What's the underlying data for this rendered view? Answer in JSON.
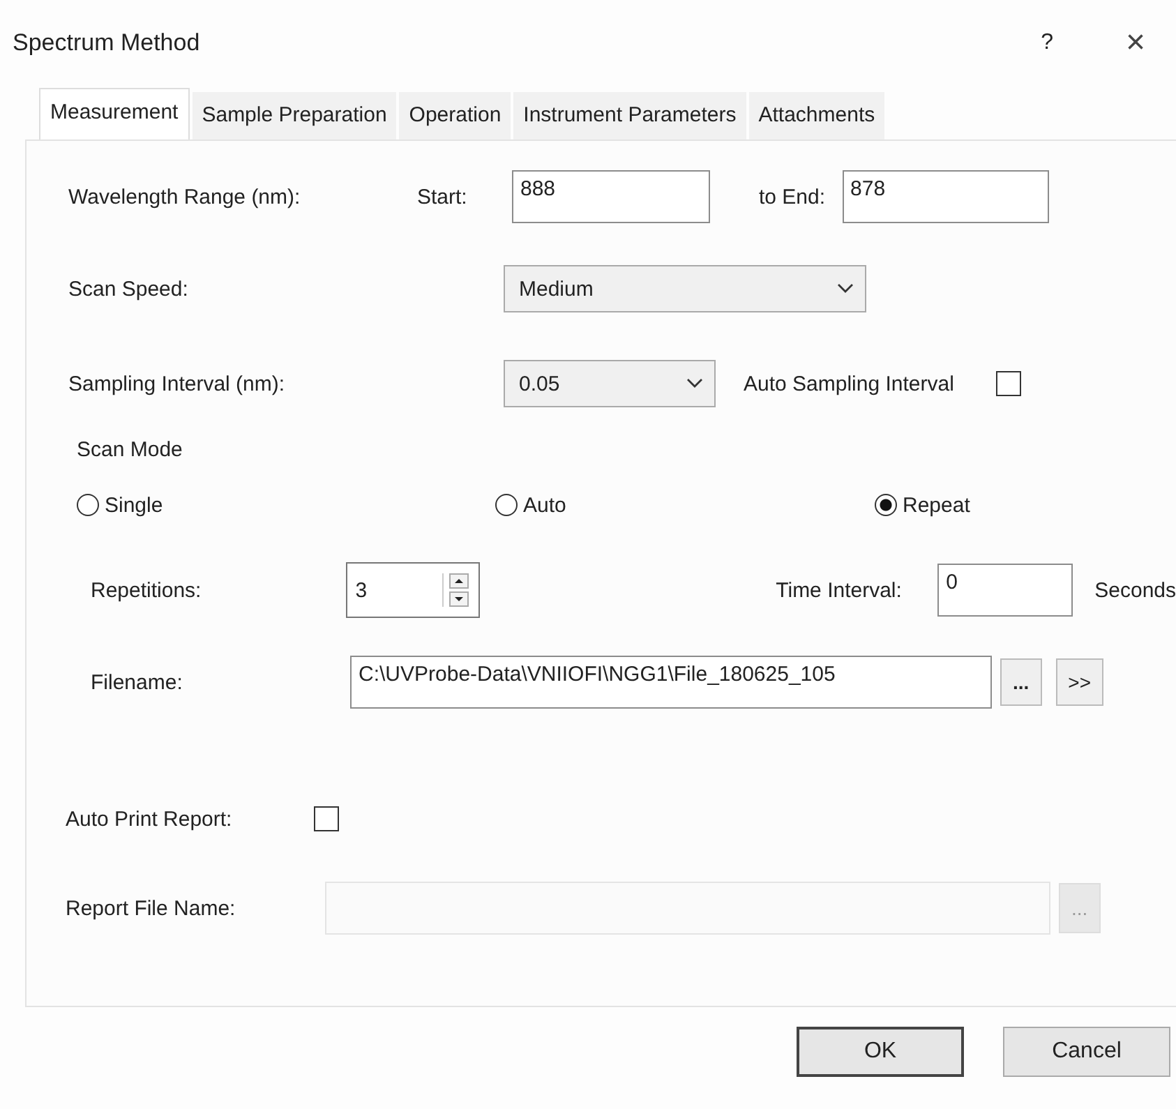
{
  "window": {
    "title": "Spectrum Method",
    "help": "?",
    "close": "×"
  },
  "tabs": [
    {
      "label": "Measurement",
      "selected": true
    },
    {
      "label": "Sample Preparation",
      "selected": false
    },
    {
      "label": "Operation",
      "selected": false
    },
    {
      "label": "Instrument Parameters",
      "selected": false
    },
    {
      "label": "Attachments",
      "selected": false
    }
  ],
  "wavelength": {
    "label": "Wavelength Range (nm):",
    "start_label": "Start:",
    "start": "888",
    "end_label": "to End:",
    "end": "878"
  },
  "scan_speed": {
    "label": "Scan Speed:",
    "value": "Medium"
  },
  "sampling_interval": {
    "label": "Sampling Interval (nm):",
    "value": "0.05",
    "auto_label": "Auto Sampling Interval",
    "auto_checked": false
  },
  "scan_mode": {
    "label": "Scan Mode",
    "options": [
      {
        "label": "Single",
        "selected": false
      },
      {
        "label": "Auto",
        "selected": false
      },
      {
        "label": "Repeat",
        "selected": true
      }
    ]
  },
  "repetitions": {
    "label": "Repetitions:",
    "value": "3"
  },
  "time_interval": {
    "label": "Time Interval:",
    "value": "0",
    "unit": "Seconds"
  },
  "filename": {
    "label": "Filename:",
    "value": "C:\\UVProbe-Data\\VNIIOFI\\NGG1\\File_180625_105",
    "browse": "...",
    "more": ">>"
  },
  "auto_print": {
    "label": "Auto Print Report:",
    "checked": false
  },
  "report_file": {
    "label": "Report File Name:",
    "browse": "...",
    "disabled": true
  },
  "buttons": [
    {
      "label": "OK",
      "default": true
    },
    {
      "label": "Cancel",
      "default": false
    }
  ]
}
